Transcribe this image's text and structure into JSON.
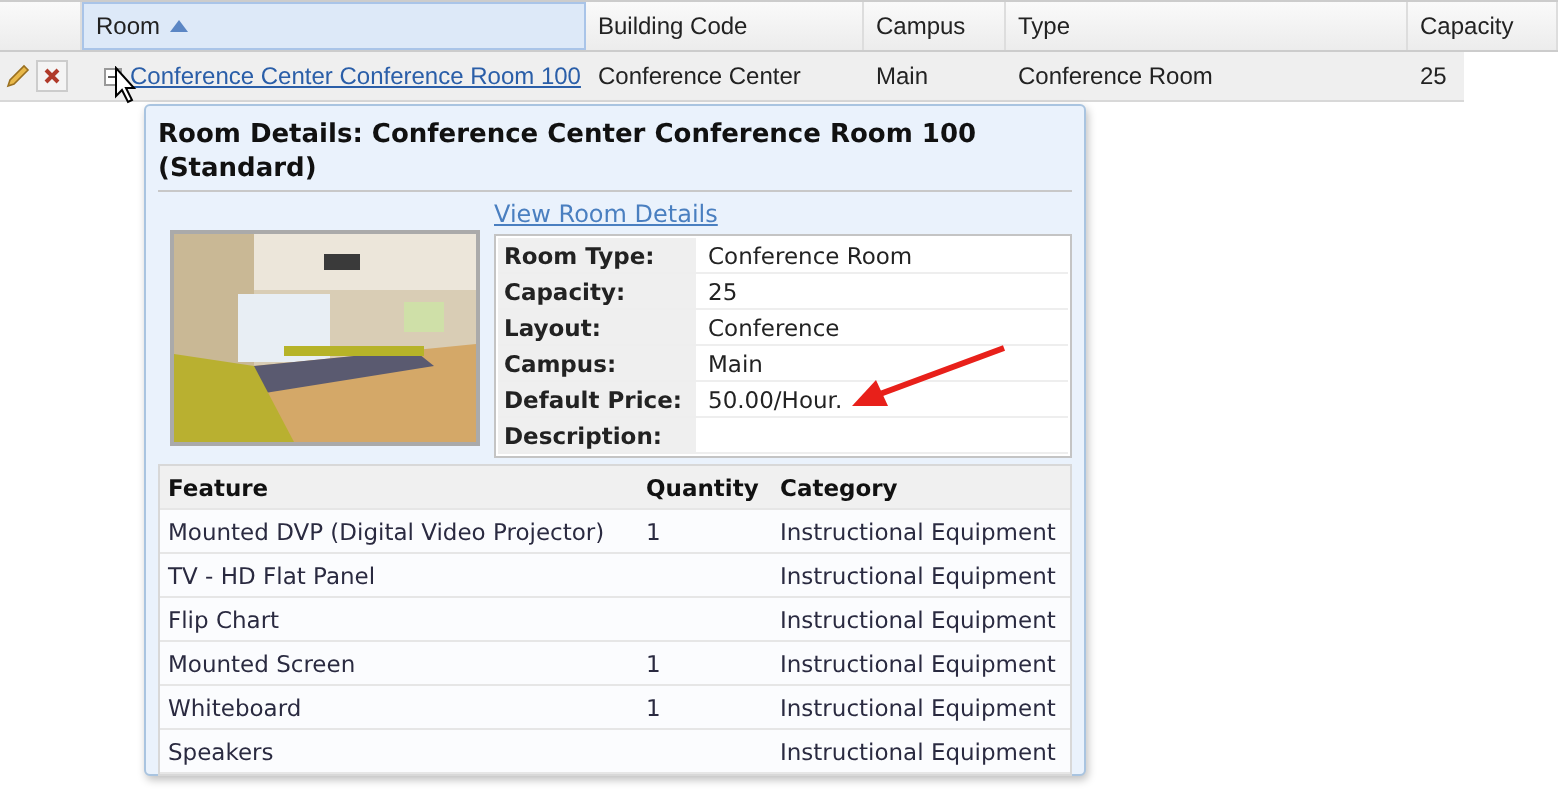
{
  "grid": {
    "columns": [
      {
        "label": "Room",
        "sorted": true
      },
      {
        "label": "Building Code",
        "sorted": false
      },
      {
        "label": "Campus",
        "sorted": false
      },
      {
        "label": "Type",
        "sorted": false
      },
      {
        "label": "Capacity",
        "sorted": false
      }
    ],
    "rows": [
      {
        "expanded": true,
        "cells": [
          "Conference Center Conference Room 100",
          "Conference Center",
          "Main",
          "Conference Room",
          "25"
        ]
      }
    ]
  },
  "popup": {
    "title": "Room Details: Conference Center Conference Room 100 (Standard)",
    "link": "View Room Details",
    "details": [
      {
        "label": "Room Type:",
        "value": "Conference Room"
      },
      {
        "label": "Capacity:",
        "value": "25"
      },
      {
        "label": "Layout:",
        "value": "Conference"
      },
      {
        "label": "Campus:",
        "value": "Main"
      },
      {
        "label": "Default Price:",
        "value": "50.00/Hour."
      },
      {
        "label": "Description:"
      }
    ],
    "features": {
      "columns": [
        "Feature",
        "Quantity",
        "Category"
      ],
      "rows": [
        [
          "Mounted DVP (Digital Video Projector)",
          "1",
          "Instructional Equipment"
        ],
        [
          "TV - HD Flat Panel",
          null,
          "Instructional Equipment"
        ],
        [
          "Flip Chart",
          null,
          "Instructional Equipment"
        ],
        [
          "Mounted Screen",
          "1",
          "Instructional Equipment"
        ],
        [
          "Whiteboard",
          "1",
          "Instructional Equipment"
        ],
        [
          "Speakers",
          null,
          "Instructional Equipment"
        ]
      ]
    }
  }
}
